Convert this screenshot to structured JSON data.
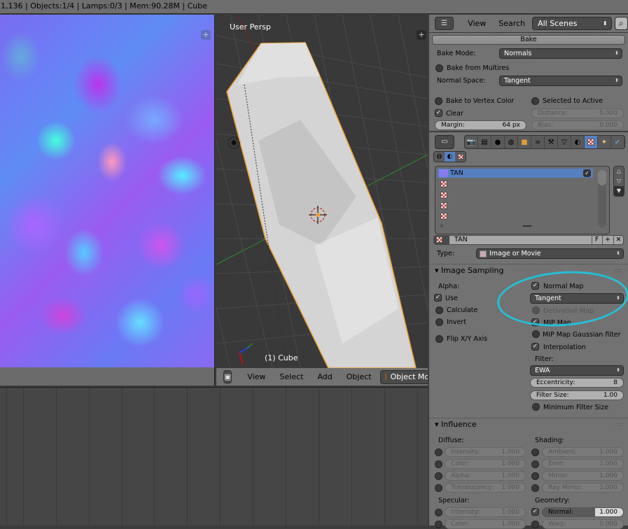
{
  "status_bar": {
    "text": "1,136 | Objects:1/4 | Lamps:0/3 | Mem:90.28M | Cube"
  },
  "image_editor": {
    "plus_icon": "+"
  },
  "viewport": {
    "view_label": "User Persp",
    "object_label": "(1) Cube",
    "header": {
      "editor_type_icon": "cube-icon",
      "menus": [
        "View",
        "Select",
        "Add",
        "Object"
      ],
      "mode": "Object Mode"
    }
  },
  "outliner_header": {
    "menus": [
      "View",
      "Search"
    ],
    "scene_filter": "All Scenes"
  },
  "bake": {
    "button": "Bake",
    "bake_mode_label": "Bake Mode:",
    "bake_mode": "Normals",
    "bake_from_multires": "Bake from Multires",
    "normal_space_label": "Normal Space:",
    "normal_space": "Tangent",
    "bake_to_vertex_color": "Bake to Vertex Color",
    "selected_to_active": "Selected to Active",
    "clear": "Clear",
    "clear_checked": true,
    "distance_label": "Distance:",
    "distance": "0.000",
    "margin_label": "Margin:",
    "margin": "64 px",
    "bias_label": "Bias:",
    "bias": "0.000"
  },
  "properties": {
    "tabs": [
      "render",
      "render-layers",
      "scene",
      "world",
      "object",
      "constraints",
      "modifiers",
      "data",
      "material",
      "texture",
      "particles",
      "physics"
    ],
    "active_tab": "texture",
    "texture_slots": [
      {
        "name": "TAN",
        "selected": true
      },
      {
        "name": ""
      },
      {
        "name": ""
      },
      {
        "name": ""
      },
      {
        "name": ""
      }
    ],
    "texture_name": "TAN",
    "fake_user": "F",
    "type_label": "Type:",
    "type": "Image or Movie"
  },
  "image_sampling": {
    "title": "Image Sampling",
    "alpha_label": "Alpha:",
    "use": "Use",
    "calculate": "Calculate",
    "invert": "Invert",
    "flip_xy": "Flip X/Y Axis",
    "normal_map": "Normal Map",
    "normal_map_space": "Tangent",
    "derivative_map": "Derivative Map",
    "mip_map": "MIP Map",
    "mip_map_gaussian": "MIP Map Gaussian filter",
    "interpolation": "Interpolation",
    "filter_label": "Filter:",
    "filter": "EWA",
    "eccentricity_label": "Eccentricity:",
    "eccentricity": "8",
    "filter_size_label": "Filter Size:",
    "filter_size": "1.00",
    "min_filter_size": "Minimum Filter Size"
  },
  "influence": {
    "title": "Influence",
    "diffuse_label": "Diffuse:",
    "diffuse": [
      {
        "label": "Intensity:",
        "value": "1.000"
      },
      {
        "label": "Color:",
        "value": "1.000"
      },
      {
        "label": "Alpha:",
        "value": "1.000"
      },
      {
        "label": "Translucency:",
        "value": "1.000"
      }
    ],
    "shading_label": "Shading:",
    "shading": [
      {
        "label": "Ambient:",
        "value": "1.000"
      },
      {
        "label": "Emit:",
        "value": "1.000"
      },
      {
        "label": "Mirror:",
        "value": "1.000"
      },
      {
        "label": "Ray Mirror:",
        "value": "1.000"
      }
    ],
    "specular_label": "Specular:",
    "specular": [
      {
        "label": "Intensity:",
        "value": "1.000"
      },
      {
        "label": "Color:",
        "value": "1.000"
      }
    ],
    "geometry_label": "Geometry:",
    "geometry": [
      {
        "label": "Normal:",
        "value": "1.000",
        "checked": true
      },
      {
        "label": "Warp:",
        "value": "0.000"
      }
    ]
  },
  "colors": {
    "selection": "#5680c2",
    "annotation": "#20c4dc",
    "object_outline": "#f0a030"
  }
}
